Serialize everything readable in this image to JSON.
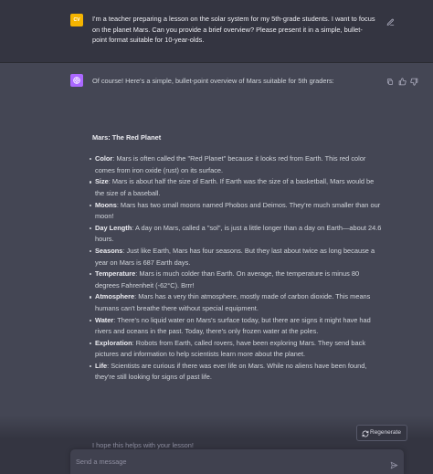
{
  "user_message": {
    "avatar_initials": "CV",
    "text": "I'm a teacher preparing a lesson on the solar system for my 5th-grade students. I want to focus on the planet Mars. Can you provide a brief overview? Please present it in a simple, bullet-point format suitable for 10-year-olds."
  },
  "assistant_message": {
    "intro": "Of course! Here's a simple, bullet-point overview of Mars suitable for 5th graders:",
    "title": "Mars: The Red Planet",
    "bullets": [
      {
        "term": "Color",
        "text": ": Mars is often called the \"Red Planet\" because it looks red from Earth. This red color comes from iron oxide (rust) on its surface."
      },
      {
        "term": "Size",
        "text": ": Mars is about half the size of Earth. If Earth was the size of a basketball, Mars would be the size of a baseball."
      },
      {
        "term": "Moons",
        "text": ": Mars has two small moons named Phobos and Deimos. They're much smaller than our moon!"
      },
      {
        "term": "Day Length",
        "text": ": A day on Mars, called a \"sol\", is just a little longer than a day on Earth—about 24.6 hours."
      },
      {
        "term": "Seasons",
        "text": ": Just like Earth, Mars has four seasons. But they last about twice as long because a year on Mars is 687 Earth days."
      },
      {
        "term": "Temperature",
        "text": ": Mars is much colder than Earth. On average, the temperature is minus 80 degrees Fahrenheit (-62°C). Brrr!"
      },
      {
        "term": "Atmosphere",
        "text": ": Mars has a very thin atmosphere, mostly made of carbon dioxide. This means humans can't breathe there without special equipment."
      },
      {
        "term": "Water",
        "text": ": There's no liquid water on Mars's surface today, but there are signs it might have had rivers and oceans in the past. Today, there's only frozen water at the poles."
      },
      {
        "term": "Exploration",
        "text": ": Robots from Earth, called rovers, have been exploring Mars. They send back pictures and information to help scientists learn more about the planet."
      },
      {
        "term": "Life",
        "text": ": Scientists are curious if there was ever life on Mars. While no aliens have been found, they're still looking for signs of past life."
      }
    ],
    "closing": "I hope this helps with your lesson!"
  },
  "regenerate_label": "Regenerate",
  "composer": {
    "placeholder": "Send a message"
  },
  "icons": {
    "edit": "edit-icon",
    "copy": "copy-icon",
    "thumbs_up": "thumbs-up-icon",
    "thumbs_down": "thumbs-down-icon",
    "regenerate": "refresh-icon",
    "send": "send-icon"
  },
  "colors": {
    "background": "#343541",
    "assistant_background": "#444654",
    "user_avatar": "#f5b400",
    "assistant_avatar": "#ab68ff"
  }
}
